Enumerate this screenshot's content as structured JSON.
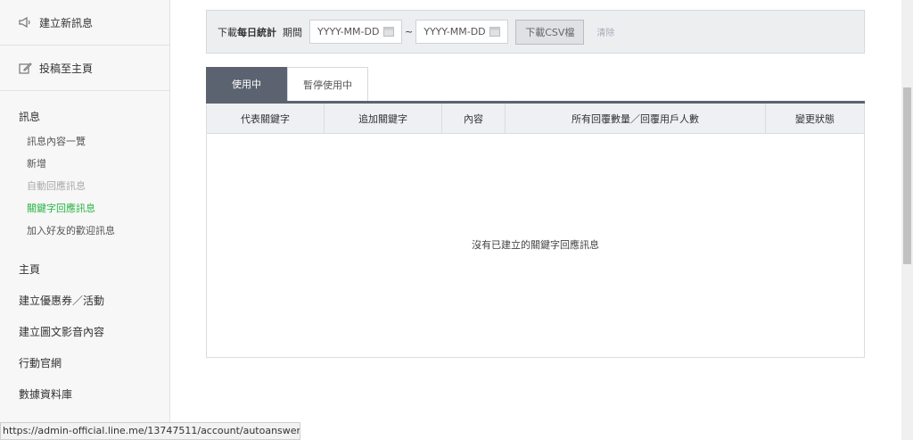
{
  "sidebar": {
    "create_message": "建立新訊息",
    "post_to_home": "投稿至主頁",
    "messages": {
      "title": "訊息",
      "items": [
        {
          "label": "訊息內容一覽",
          "state": "normal"
        },
        {
          "label": "新增",
          "state": "normal"
        },
        {
          "label": "自動回應訊息",
          "state": "dim"
        },
        {
          "label": "關鍵字回應訊息",
          "state": "active"
        },
        {
          "label": "加入好友的歡迎訊息",
          "state": "normal"
        }
      ]
    },
    "nav": [
      "主頁",
      "建立優惠券／活動",
      "建立圖文影音內容",
      "行動官網",
      "數據資料庫"
    ]
  },
  "filter": {
    "label_prefix": "下載",
    "label_bold": "每日統計",
    "period": "期間",
    "start_placeholder": "YYYY-MM-DD",
    "end_placeholder": "YYYY-MM-DD",
    "tilde": "~",
    "csv_button": "下載CSV檔",
    "clear_link": "清除"
  },
  "tabs": {
    "active": "使用中",
    "inactive": "暫停使用中"
  },
  "table": {
    "columns": [
      "代表關鍵字",
      "追加關鍵字",
      "內容",
      "所有回覆數量／回覆用戶人數",
      "變更狀態"
    ],
    "empty_message": "沒有已建立的關鍵字回應訊息"
  },
  "status_url": "https://admin-official.line.me/13747511/account/autoanswer/#/",
  "colors": {
    "active_green": "#28b446",
    "tab_active": "#5b6370"
  }
}
